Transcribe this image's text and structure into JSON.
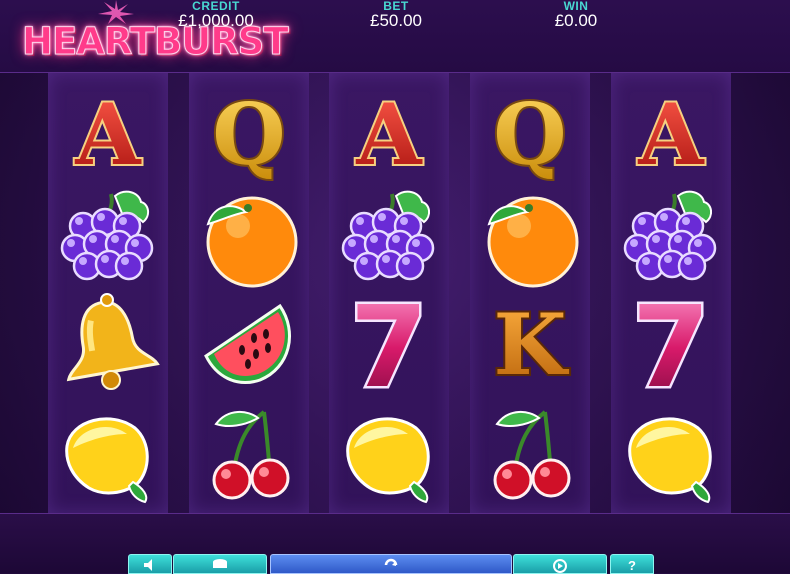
{
  "game": {
    "logo_text": "HEARTBURST"
  },
  "meters": {
    "credit": {
      "label": "CREDIT",
      "value": "£1,000.00"
    },
    "bet": {
      "label": "BET",
      "value": "£50.00"
    },
    "win": {
      "label": "WIN",
      "value": "£0.00"
    }
  },
  "reels": [
    [
      "ace",
      "grapes",
      "bell",
      "lemon"
    ],
    [
      "queen",
      "orange",
      "watermelon",
      "cherries"
    ],
    [
      "ace",
      "grapes",
      "seven",
      "lemon"
    ],
    [
      "queen",
      "orange",
      "king",
      "cherries"
    ],
    [
      "ace",
      "grapes",
      "seven",
      "lemon"
    ]
  ],
  "symbol_letters": {
    "ace": "A",
    "queen": "Q",
    "king": "K",
    "seven": "7"
  },
  "controls": [
    {
      "name": "sound-icon"
    },
    {
      "name": "coins-icon"
    },
    {
      "name": "spin-icon"
    },
    {
      "name": "autoplay-icon"
    },
    {
      "name": "help-icon"
    }
  ],
  "colors": {
    "credit_label": "#49d8d2",
    "accent": "#ff3b8a",
    "button": "#3ee0da"
  }
}
